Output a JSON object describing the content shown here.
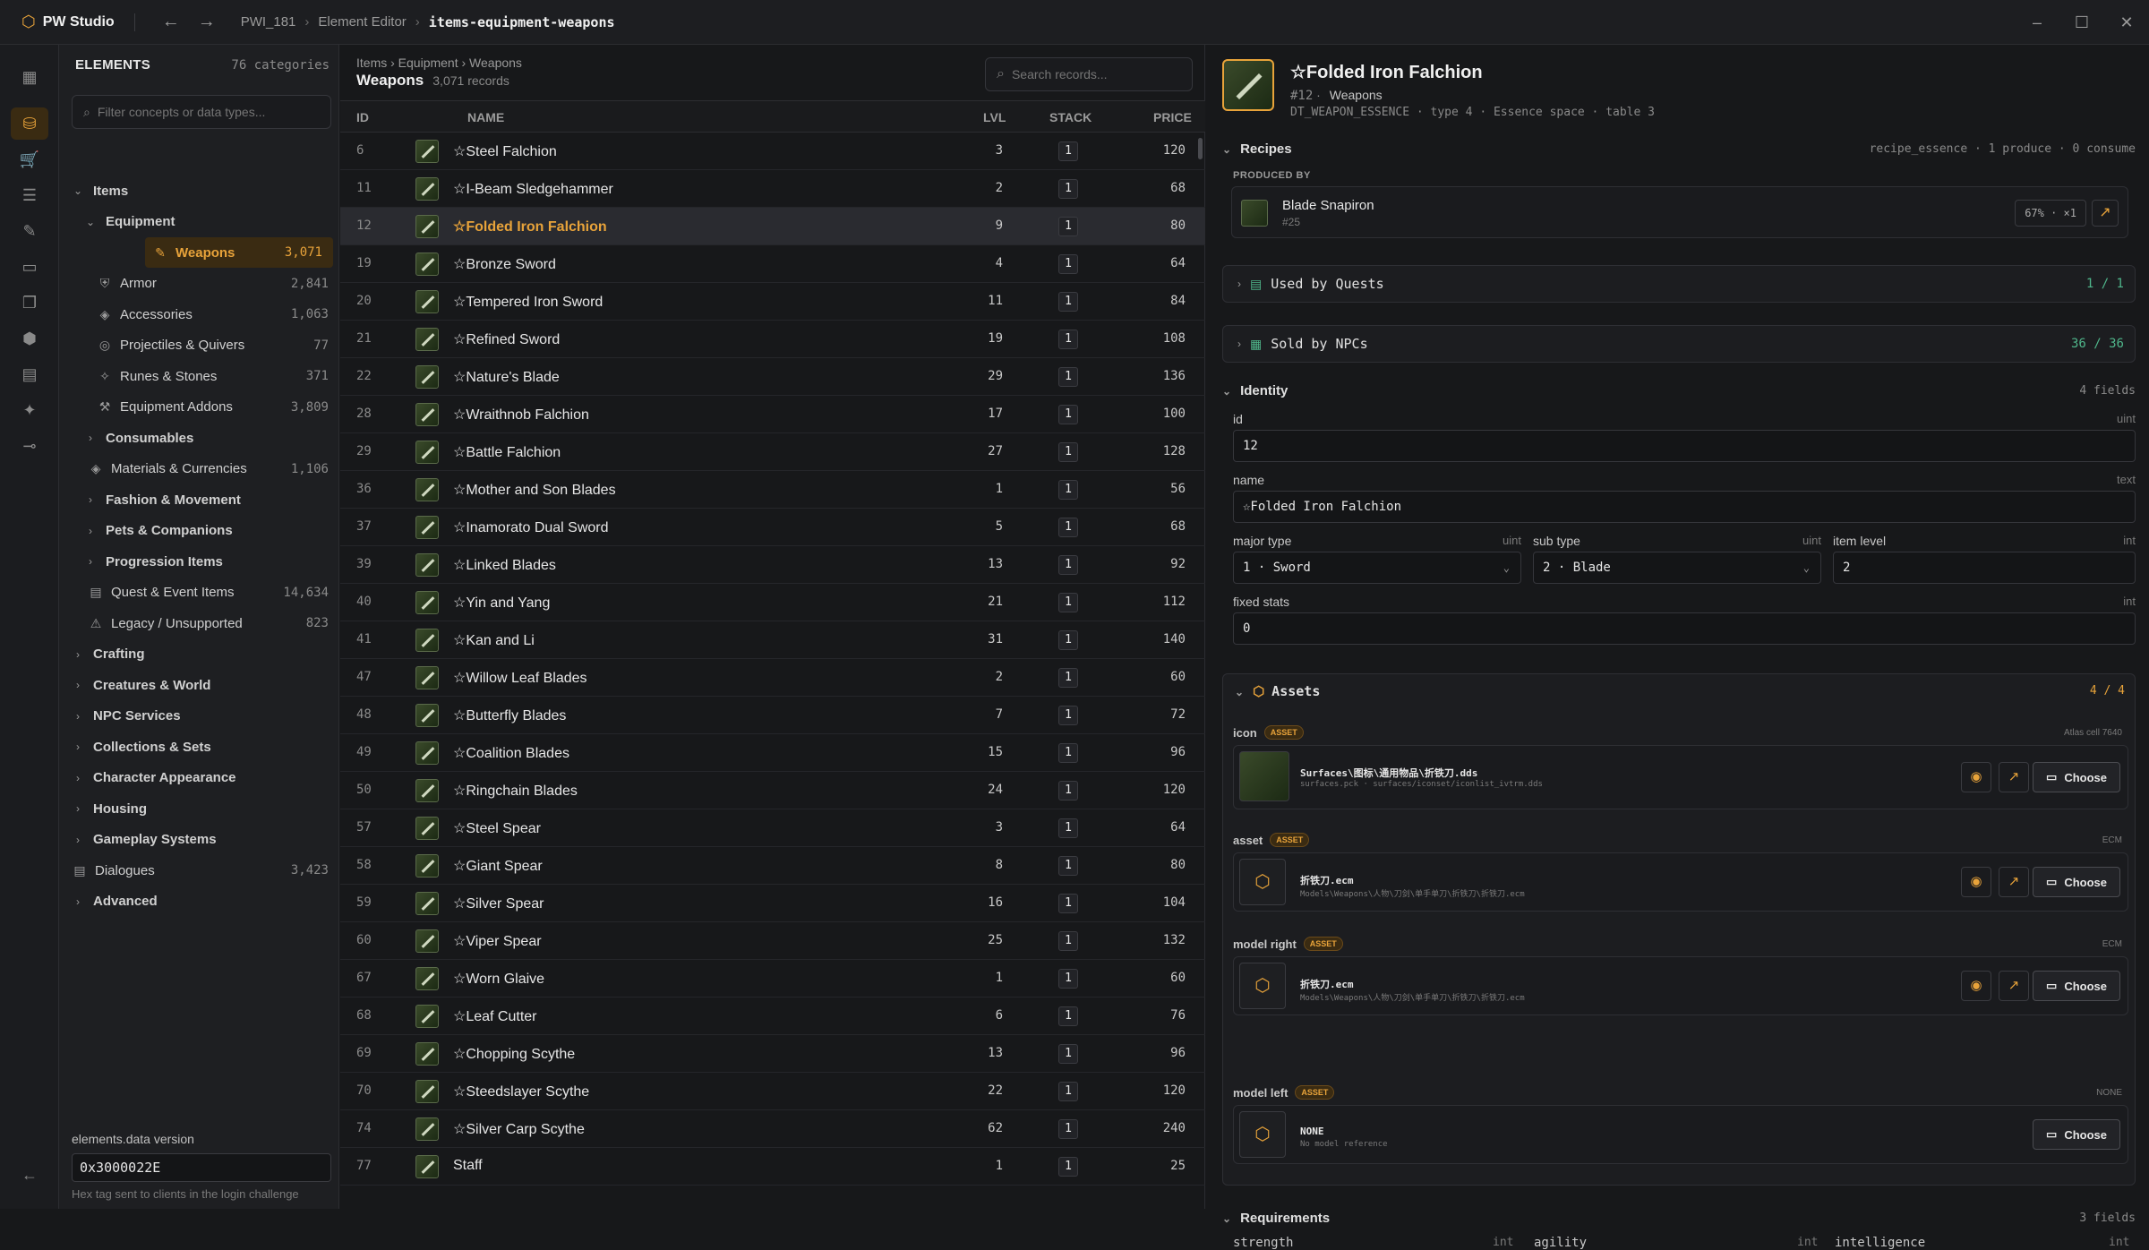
{
  "app": {
    "name": "PW Studio",
    "logo_icon": "hex-logo-icon"
  },
  "breadcrumb": [
    "PWI_181",
    "Element Editor",
    "items-equipment-weapons"
  ],
  "sidebar": {
    "title": "ELEMENTS",
    "count": "76 categories",
    "filter_placeholder": "Filter concepts or data types...",
    "tree": [
      {
        "label": "Items",
        "level": 0,
        "expanded": true,
        "count": ""
      },
      {
        "label": "Equipment",
        "level": 1,
        "expanded": true,
        "count": ""
      },
      {
        "label": "Weapons",
        "level": 2,
        "count": "3,071",
        "selected": true
      },
      {
        "label": "Armor",
        "level": 2,
        "count": "2,841"
      },
      {
        "label": "Accessories",
        "level": 2,
        "count": "1,063"
      },
      {
        "label": "Projectiles & Quivers",
        "level": 2,
        "count": "77"
      },
      {
        "label": "Runes & Stones",
        "level": 2,
        "count": "371"
      },
      {
        "label": "Equipment Addons",
        "level": 2,
        "count": "3,809"
      },
      {
        "label": "Consumables",
        "level": 1,
        "count": ""
      },
      {
        "label": "Materials & Currencies",
        "level": 1,
        "count": "1,106"
      },
      {
        "label": "Fashion & Movement",
        "level": 1,
        "count": ""
      },
      {
        "label": "Pets & Companions",
        "level": 1,
        "count": ""
      },
      {
        "label": "Progression Items",
        "level": 1,
        "count": ""
      },
      {
        "label": "Quest & Event Items",
        "level": 1,
        "count": "14,634"
      },
      {
        "label": "Legacy / Unsupported",
        "level": 1,
        "count": "823"
      },
      {
        "label": "Crafting",
        "level": 0,
        "count": ""
      },
      {
        "label": "Creatures & World",
        "level": 0,
        "count": ""
      },
      {
        "label": "NPC Services",
        "level": 0,
        "count": ""
      },
      {
        "label": "Collections & Sets",
        "level": 0,
        "count": ""
      },
      {
        "label": "Character Appearance",
        "level": 0,
        "count": ""
      },
      {
        "label": "Housing",
        "level": 0,
        "count": ""
      },
      {
        "label": "Gameplay Systems",
        "level": 0,
        "count": ""
      },
      {
        "label": "Dialogues",
        "level": 0,
        "count": "3,423"
      },
      {
        "label": "Advanced",
        "level": 0,
        "count": ""
      }
    ],
    "version_label": "elements.data version",
    "version_value": "0x3000022E",
    "version_hint": "Hex tag sent to clients in the login challenge"
  },
  "list": {
    "breadcrumb": "Items › Equipment › Weapons",
    "title": "Weapons",
    "records": "3,071 records",
    "search_placeholder": "Search records...",
    "columns": {
      "id": "ID",
      "name": "NAME",
      "lvl": "LVL",
      "stack": "STACK",
      "price": "PRICE"
    },
    "rows": [
      {
        "id": "6",
        "name": "☆Steel Falchion",
        "lvl": "3",
        "stack": "1",
        "price": "120"
      },
      {
        "id": "11",
        "name": "☆I-Beam Sledgehammer",
        "lvl": "2",
        "stack": "1",
        "price": "68"
      },
      {
        "id": "12",
        "name": "☆Folded Iron Falchion",
        "lvl": "9",
        "stack": "1",
        "price": "80",
        "selected": true
      },
      {
        "id": "19",
        "name": "☆Bronze Sword",
        "lvl": "4",
        "stack": "1",
        "price": "64"
      },
      {
        "id": "20",
        "name": "☆Tempered Iron Sword",
        "lvl": "11",
        "stack": "1",
        "price": "84"
      },
      {
        "id": "21",
        "name": "☆Refined Sword",
        "lvl": "19",
        "stack": "1",
        "price": "108"
      },
      {
        "id": "22",
        "name": "☆Nature's Blade",
        "lvl": "29",
        "stack": "1",
        "price": "136"
      },
      {
        "id": "28",
        "name": "☆Wraithnob Falchion",
        "lvl": "17",
        "stack": "1",
        "price": "100"
      },
      {
        "id": "29",
        "name": "☆Battle Falchion",
        "lvl": "27",
        "stack": "1",
        "price": "128"
      },
      {
        "id": "36",
        "name": "☆Mother and Son Blades",
        "lvl": "1",
        "stack": "1",
        "price": "56"
      },
      {
        "id": "37",
        "name": "☆Inamorato Dual Sword",
        "lvl": "5",
        "stack": "1",
        "price": "68"
      },
      {
        "id": "39",
        "name": "☆Linked Blades",
        "lvl": "13",
        "stack": "1",
        "price": "92"
      },
      {
        "id": "40",
        "name": "☆Yin and Yang",
        "lvl": "21",
        "stack": "1",
        "price": "112"
      },
      {
        "id": "41",
        "name": "☆Kan and Li",
        "lvl": "31",
        "stack": "1",
        "price": "140"
      },
      {
        "id": "47",
        "name": "☆Willow Leaf Blades",
        "lvl": "2",
        "stack": "1",
        "price": "60"
      },
      {
        "id": "48",
        "name": "☆Butterfly Blades",
        "lvl": "7",
        "stack": "1",
        "price": "72"
      },
      {
        "id": "49",
        "name": "☆Coalition Blades",
        "lvl": "15",
        "stack": "1",
        "price": "96"
      },
      {
        "id": "50",
        "name": "☆Ringchain Blades",
        "lvl": "24",
        "stack": "1",
        "price": "120"
      },
      {
        "id": "57",
        "name": "☆Steel Spear",
        "lvl": "3",
        "stack": "1",
        "price": "64"
      },
      {
        "id": "58",
        "name": "☆Giant Spear",
        "lvl": "8",
        "stack": "1",
        "price": "80"
      },
      {
        "id": "59",
        "name": "☆Silver Spear",
        "lvl": "16",
        "stack": "1",
        "price": "104"
      },
      {
        "id": "60",
        "name": "☆Viper Spear",
        "lvl": "25",
        "stack": "1",
        "price": "132"
      },
      {
        "id": "67",
        "name": "☆Worn Glaive",
        "lvl": "1",
        "stack": "1",
        "price": "60"
      },
      {
        "id": "68",
        "name": "☆Leaf Cutter",
        "lvl": "6",
        "stack": "1",
        "price": "76"
      },
      {
        "id": "69",
        "name": "☆Chopping Scythe",
        "lvl": "13",
        "stack": "1",
        "price": "96"
      },
      {
        "id": "70",
        "name": "☆Steedslayer Scythe",
        "lvl": "22",
        "stack": "1",
        "price": "120"
      },
      {
        "id": "74",
        "name": "☆Silver Carp Scythe",
        "lvl": "62",
        "stack": "1",
        "price": "240"
      },
      {
        "id": "77",
        "name": "Staff",
        "lvl": "1",
        "stack": "1",
        "price": "25"
      }
    ]
  },
  "detail": {
    "title": "☆Folded Iron Falchion",
    "subtitle_id": "#12",
    "subtitle_cat": "Weapons",
    "meta": "DT_WEAPON_ESSENCE · type 4 · Essence space · table 3",
    "recipes": {
      "label": "Recipes",
      "right": "recipe_essence · 1 produce · 0 consume",
      "produced_by": "PRODUCED BY",
      "producer_name": "Blade Snapiron",
      "producer_id": "#25",
      "chip": "67% · ×1"
    },
    "used_by_quests": {
      "label": "Used by Quests",
      "count": "1 / 1"
    },
    "sold_by_npcs": {
      "label": "Sold by NPCs",
      "count": "36 / 36"
    },
    "identity": {
      "label": "Identity",
      "right": "4 fields",
      "id_label": "id",
      "id_type": "uint",
      "id_value": "12",
      "name_label": "name",
      "name_type": "text",
      "name_value": "☆Folded Iron Falchion",
      "major_label": "major type",
      "major_type": "uint",
      "major_value": "1 · Sword",
      "sub_label": "sub type",
      "sub_type": "uint",
      "sub_value": "2 · Blade",
      "level_label": "item level",
      "level_type": "int",
      "level_value": "2",
      "fixed_label": "fixed stats",
      "fixed_type": "int",
      "fixed_value": "0"
    },
    "assets": {
      "label": "Assets",
      "count": "4 / 4",
      "tag": "ASSET",
      "choose": "Choose",
      "icon": {
        "label": "icon",
        "right": "Atlas cell 7640",
        "p1": "Surfaces\\图标\\通用物品\\折铁刀.dds",
        "p2": "surfaces.pck · surfaces/iconset/iconlist_ivtrm.dds"
      },
      "asset": {
        "label": "asset",
        "right": "ECM",
        "p1": "折铁刀.ecm",
        "p2": "Models\\Weapons\\人物\\刀剑\\单手单刀\\折铁刀\\折铁刀.ecm"
      },
      "model_right": {
        "label": "model right",
        "right": "ECM",
        "p1": "折铁刀.ecm",
        "p2": "Models\\Weapons\\人物\\刀剑\\单手单刀\\折铁刀\\折铁刀.ecm"
      },
      "model_left": {
        "label": "model left",
        "right": "NONE",
        "p1": "NONE",
        "p2": "No model reference"
      }
    },
    "requirements": {
      "label": "Requirements",
      "right": "3 fields",
      "f1": "strength",
      "t1": "int",
      "f2": "agility",
      "t2": "int",
      "f3": "intelligence",
      "t3": "int"
    }
  },
  "colors": {
    "accent": "#e8a33a",
    "success": "#4fb58a",
    "bg": "#17181a"
  }
}
